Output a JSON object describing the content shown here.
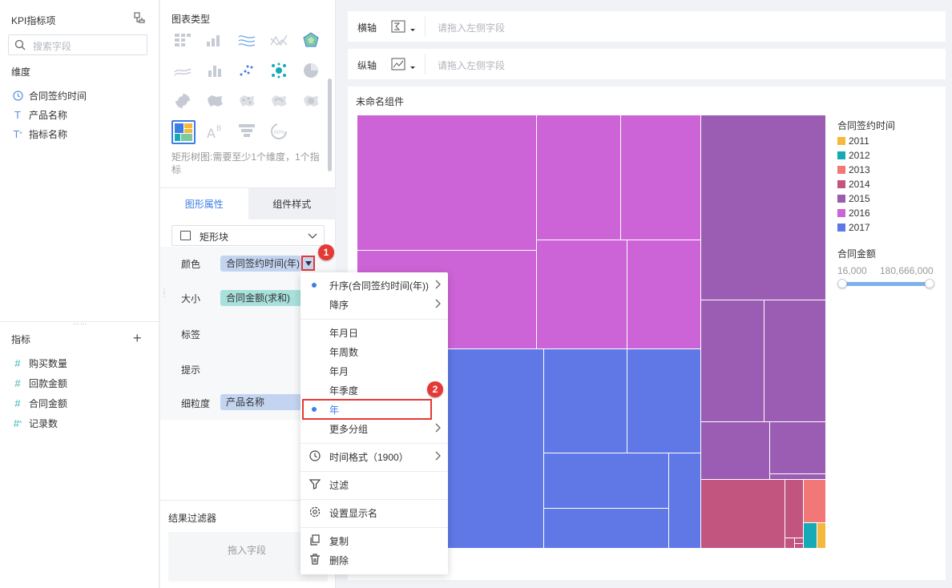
{
  "left_panel": {
    "title": "KPI指标项",
    "search_placeholder": "搜索字段",
    "dimension_label": "维度",
    "dimensions": [
      {
        "label": "合同签约时间",
        "icon": "clock-icon"
      },
      {
        "label": "产品名称",
        "icon": "text-type-icon"
      },
      {
        "label": "指标名称",
        "icon": "text-type-star-icon"
      }
    ],
    "metric_label": "指标",
    "metrics": [
      {
        "label": "购买数量",
        "icon": "hash-icon"
      },
      {
        "label": "回款金额",
        "icon": "hash-icon"
      },
      {
        "label": "合同金额",
        "icon": "hash-icon"
      },
      {
        "label": "记录数",
        "icon": "hash-star-icon"
      }
    ]
  },
  "chart_type_panel": {
    "title": "图表类型",
    "hint": "矩形树图:需要至少1个维度，1个指标",
    "tabs": {
      "active": "图形属性",
      "inactive": "组件样式"
    },
    "shape_select": "矩形块",
    "props": {
      "color_label": "颜色",
      "color_field": "合同签约时间(年)",
      "size_label": "大小",
      "size_field": "合同金额(求和)",
      "label_label": "标签",
      "tooltip_label": "提示",
      "granularity_label": "细粒度",
      "granularity_field": "产品名称"
    },
    "result_filter_title": "结果过滤器",
    "result_filter_drop": "拖入字段"
  },
  "axes": {
    "x_label": "横轴",
    "y_label": "纵轴",
    "placeholder": "请拖入左侧字段"
  },
  "component": {
    "title": "未命名组件",
    "legend_title": "合同签约时间",
    "legend": [
      {
        "label": "2011",
        "color": "#f5b83d"
      },
      {
        "label": "2012",
        "color": "#16aab7"
      },
      {
        "label": "2013",
        "color": "#f27878"
      },
      {
        "label": "2014",
        "color": "#c2557f"
      },
      {
        "label": "2015",
        "color": "#9b5db3"
      },
      {
        "label": "2016",
        "color": "#cc63d6"
      },
      {
        "label": "2017",
        "color": "#5f78e6"
      }
    ],
    "size_legend_title": "合同金额",
    "size_min": "16,000",
    "size_max": "180,666,000"
  },
  "menu": {
    "items": {
      "asc": "升序(合同签约时间(年))",
      "desc": "降序",
      "ymd": "年月日",
      "yw": "年周数",
      "ym": "年月",
      "yq": "年季度",
      "y": "年",
      "more_group": "更多分组",
      "time_format": "时间格式（1900）",
      "filter": "过滤",
      "display_name": "设置显示名",
      "copy": "复制",
      "delete": "删除"
    }
  },
  "badges": {
    "one": "1",
    "two": "2"
  }
}
